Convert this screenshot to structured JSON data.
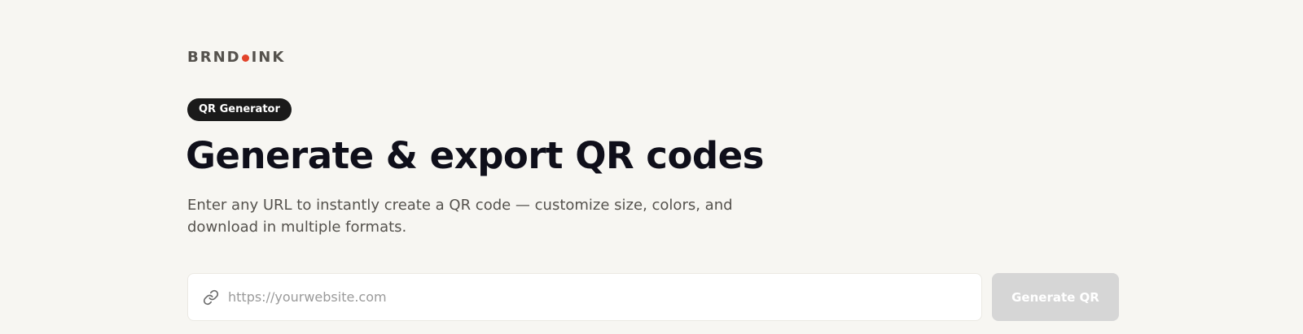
{
  "brand": {
    "left": "BRND",
    "right": "INK",
    "dot_color": "#e2432a"
  },
  "badge": {
    "label": "QR Generator"
  },
  "hero": {
    "title": "Generate & export QR codes",
    "subtitle": "Enter any URL to instantly create a QR code — customize size, colors, and download in multiple formats."
  },
  "form": {
    "url_icon": "link-icon",
    "url_value": "",
    "url_placeholder": "https://yourwebsite.com",
    "generate_label": "Generate QR",
    "generate_disabled": true
  },
  "colors": {
    "background": "#f7f6f2",
    "badge_bg": "#1a1a1a",
    "title": "#0f0f1a",
    "button_disabled": "#d6d6d6"
  }
}
